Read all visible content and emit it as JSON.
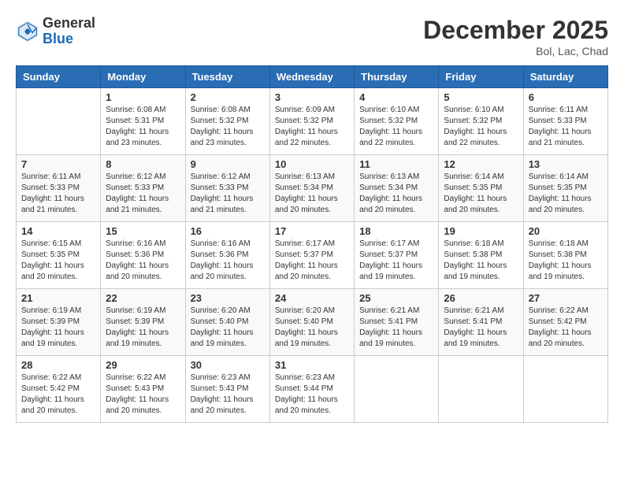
{
  "header": {
    "logo_general": "General",
    "logo_blue": "Blue",
    "month_title": "December 2025",
    "location": "Bol, Lac, Chad"
  },
  "days_of_week": [
    "Sunday",
    "Monday",
    "Tuesday",
    "Wednesday",
    "Thursday",
    "Friday",
    "Saturday"
  ],
  "weeks": [
    [
      {
        "day": "",
        "sunrise": "",
        "sunset": "",
        "daylight": ""
      },
      {
        "day": "1",
        "sunrise": "Sunrise: 6:08 AM",
        "sunset": "Sunset: 5:31 PM",
        "daylight": "Daylight: 11 hours and 23 minutes."
      },
      {
        "day": "2",
        "sunrise": "Sunrise: 6:08 AM",
        "sunset": "Sunset: 5:32 PM",
        "daylight": "Daylight: 11 hours and 23 minutes."
      },
      {
        "day": "3",
        "sunrise": "Sunrise: 6:09 AM",
        "sunset": "Sunset: 5:32 PM",
        "daylight": "Daylight: 11 hours and 22 minutes."
      },
      {
        "day": "4",
        "sunrise": "Sunrise: 6:10 AM",
        "sunset": "Sunset: 5:32 PM",
        "daylight": "Daylight: 11 hours and 22 minutes."
      },
      {
        "day": "5",
        "sunrise": "Sunrise: 6:10 AM",
        "sunset": "Sunset: 5:32 PM",
        "daylight": "Daylight: 11 hours and 22 minutes."
      },
      {
        "day": "6",
        "sunrise": "Sunrise: 6:11 AM",
        "sunset": "Sunset: 5:33 PM",
        "daylight": "Daylight: 11 hours and 21 minutes."
      }
    ],
    [
      {
        "day": "7",
        "sunrise": "Sunrise: 6:11 AM",
        "sunset": "Sunset: 5:33 PM",
        "daylight": "Daylight: 11 hours and 21 minutes."
      },
      {
        "day": "8",
        "sunrise": "Sunrise: 6:12 AM",
        "sunset": "Sunset: 5:33 PM",
        "daylight": "Daylight: 11 hours and 21 minutes."
      },
      {
        "day": "9",
        "sunrise": "Sunrise: 6:12 AM",
        "sunset": "Sunset: 5:33 PM",
        "daylight": "Daylight: 11 hours and 21 minutes."
      },
      {
        "day": "10",
        "sunrise": "Sunrise: 6:13 AM",
        "sunset": "Sunset: 5:34 PM",
        "daylight": "Daylight: 11 hours and 20 minutes."
      },
      {
        "day": "11",
        "sunrise": "Sunrise: 6:13 AM",
        "sunset": "Sunset: 5:34 PM",
        "daylight": "Daylight: 11 hours and 20 minutes."
      },
      {
        "day": "12",
        "sunrise": "Sunrise: 6:14 AM",
        "sunset": "Sunset: 5:35 PM",
        "daylight": "Daylight: 11 hours and 20 minutes."
      },
      {
        "day": "13",
        "sunrise": "Sunrise: 6:14 AM",
        "sunset": "Sunset: 5:35 PM",
        "daylight": "Daylight: 11 hours and 20 minutes."
      }
    ],
    [
      {
        "day": "14",
        "sunrise": "Sunrise: 6:15 AM",
        "sunset": "Sunset: 5:35 PM",
        "daylight": "Daylight: 11 hours and 20 minutes."
      },
      {
        "day": "15",
        "sunrise": "Sunrise: 6:16 AM",
        "sunset": "Sunset: 5:36 PM",
        "daylight": "Daylight: 11 hours and 20 minutes."
      },
      {
        "day": "16",
        "sunrise": "Sunrise: 6:16 AM",
        "sunset": "Sunset: 5:36 PM",
        "daylight": "Daylight: 11 hours and 20 minutes."
      },
      {
        "day": "17",
        "sunrise": "Sunrise: 6:17 AM",
        "sunset": "Sunset: 5:37 PM",
        "daylight": "Daylight: 11 hours and 20 minutes."
      },
      {
        "day": "18",
        "sunrise": "Sunrise: 6:17 AM",
        "sunset": "Sunset: 5:37 PM",
        "daylight": "Daylight: 11 hours and 19 minutes."
      },
      {
        "day": "19",
        "sunrise": "Sunrise: 6:18 AM",
        "sunset": "Sunset: 5:38 PM",
        "daylight": "Daylight: 11 hours and 19 minutes."
      },
      {
        "day": "20",
        "sunrise": "Sunrise: 6:18 AM",
        "sunset": "Sunset: 5:38 PM",
        "daylight": "Daylight: 11 hours and 19 minutes."
      }
    ],
    [
      {
        "day": "21",
        "sunrise": "Sunrise: 6:19 AM",
        "sunset": "Sunset: 5:39 PM",
        "daylight": "Daylight: 11 hours and 19 minutes."
      },
      {
        "day": "22",
        "sunrise": "Sunrise: 6:19 AM",
        "sunset": "Sunset: 5:39 PM",
        "daylight": "Daylight: 11 hours and 19 minutes."
      },
      {
        "day": "23",
        "sunrise": "Sunrise: 6:20 AM",
        "sunset": "Sunset: 5:40 PM",
        "daylight": "Daylight: 11 hours and 19 minutes."
      },
      {
        "day": "24",
        "sunrise": "Sunrise: 6:20 AM",
        "sunset": "Sunset: 5:40 PM",
        "daylight": "Daylight: 11 hours and 19 minutes."
      },
      {
        "day": "25",
        "sunrise": "Sunrise: 6:21 AM",
        "sunset": "Sunset: 5:41 PM",
        "daylight": "Daylight: 11 hours and 19 minutes."
      },
      {
        "day": "26",
        "sunrise": "Sunrise: 6:21 AM",
        "sunset": "Sunset: 5:41 PM",
        "daylight": "Daylight: 11 hours and 19 minutes."
      },
      {
        "day": "27",
        "sunrise": "Sunrise: 6:22 AM",
        "sunset": "Sunset: 5:42 PM",
        "daylight": "Daylight: 11 hours and 20 minutes."
      }
    ],
    [
      {
        "day": "28",
        "sunrise": "Sunrise: 6:22 AM",
        "sunset": "Sunset: 5:42 PM",
        "daylight": "Daylight: 11 hours and 20 minutes."
      },
      {
        "day": "29",
        "sunrise": "Sunrise: 6:22 AM",
        "sunset": "Sunset: 5:43 PM",
        "daylight": "Daylight: 11 hours and 20 minutes."
      },
      {
        "day": "30",
        "sunrise": "Sunrise: 6:23 AM",
        "sunset": "Sunset: 5:43 PM",
        "daylight": "Daylight: 11 hours and 20 minutes."
      },
      {
        "day": "31",
        "sunrise": "Sunrise: 6:23 AM",
        "sunset": "Sunset: 5:44 PM",
        "daylight": "Daylight: 11 hours and 20 minutes."
      },
      {
        "day": "",
        "sunrise": "",
        "sunset": "",
        "daylight": ""
      },
      {
        "day": "",
        "sunrise": "",
        "sunset": "",
        "daylight": ""
      },
      {
        "day": "",
        "sunrise": "",
        "sunset": "",
        "daylight": ""
      }
    ]
  ]
}
